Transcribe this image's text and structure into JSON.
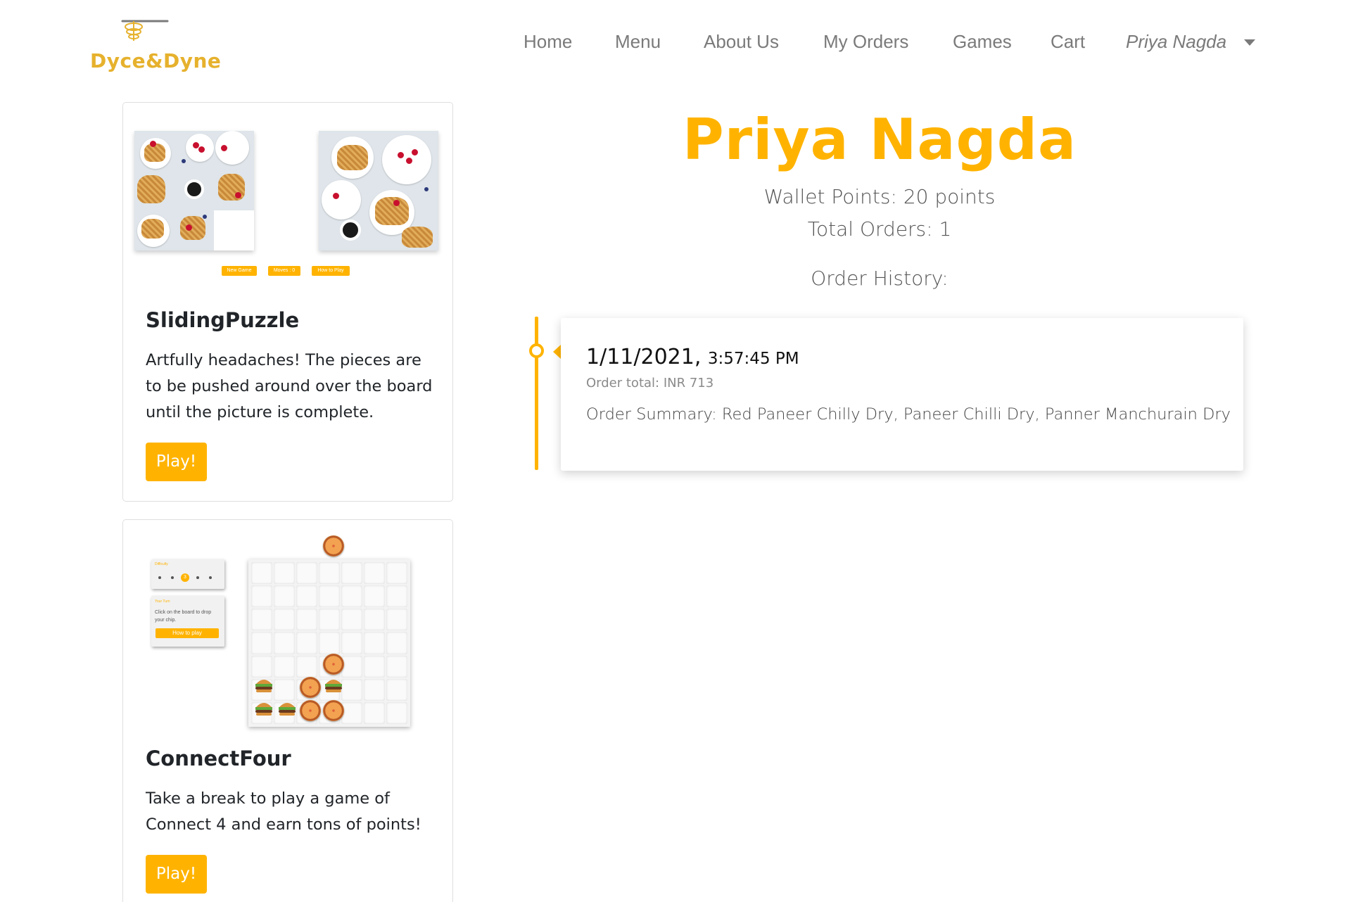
{
  "brand": {
    "name": "Dyce&Dyne",
    "logo_icon": "whisk-icon",
    "color": "#e6b12d"
  },
  "nav": {
    "items": [
      "Home",
      "Menu",
      "About Us",
      "My Orders",
      "Games",
      "Cart"
    ],
    "user_label": "Priya Nagda"
  },
  "games": [
    {
      "title": "SlidingPuzzle",
      "description": "Artfully headaches! The pieces are to be pushed around over the board until the picture is complete.",
      "button": "Play!",
      "preview_buttons": [
        "New Game",
        "Moves : 0",
        "How to Play"
      ]
    },
    {
      "title": "ConnectFour",
      "description": "Take a break to play a game of Connect 4 and earn tons of points!",
      "button": "Play!",
      "preview": {
        "difficulty_label": "Difficulty",
        "difficulty_value": "3",
        "turn_label": "Your Turn",
        "turn_text": "Click on the board to drop your chip.",
        "how_to": "How to play"
      }
    }
  ],
  "profile": {
    "name": "Priya Nagda",
    "wallet": "Wallet Points: 20 points",
    "orders": "Total Orders: 1",
    "history_label": "Order History:"
  },
  "order_history": [
    {
      "date": "1/11/2021,",
      "time": "3:57:45 PM",
      "total": "Order total: INR 713",
      "summary": "Order Summary: Red Paneer Chilly Dry, Paneer Chilli Dry, Panner Manchurain Dry"
    }
  ],
  "colors": {
    "accent": "#ffb300",
    "nav_text": "#7a7a7a"
  }
}
